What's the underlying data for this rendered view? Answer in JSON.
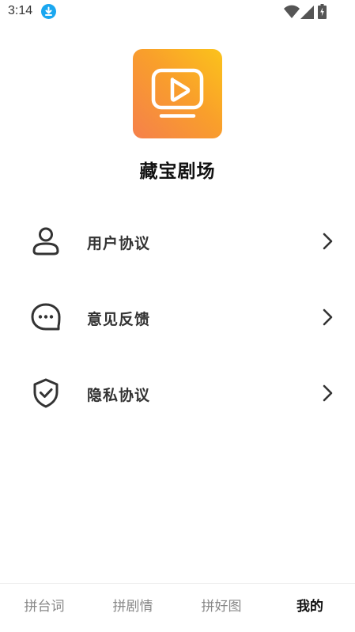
{
  "status_bar": {
    "time": "3:14",
    "download_icon": "download-icon",
    "wifi_icon": "wifi-icon",
    "signal_icon": "signal-icon",
    "battery_icon": "battery-icon",
    "download_color": "#1aa7f0"
  },
  "app": {
    "name": "藏宝剧场",
    "logo_icon": "tv-play-icon",
    "logo_gradient": [
      "#fbc31b",
      "#f5804b"
    ]
  },
  "menu": {
    "items": [
      {
        "label": "用户协议",
        "icon": "user-icon"
      },
      {
        "label": "意见反馈",
        "icon": "chat-bubble-icon"
      },
      {
        "label": "隐私协议",
        "icon": "shield-check-icon"
      }
    ]
  },
  "tabs": {
    "items": [
      {
        "label": "拼台词",
        "active": false
      },
      {
        "label": "拼剧情",
        "active": false
      },
      {
        "label": "拼好图",
        "active": false
      },
      {
        "label": "我的",
        "active": true
      }
    ]
  }
}
